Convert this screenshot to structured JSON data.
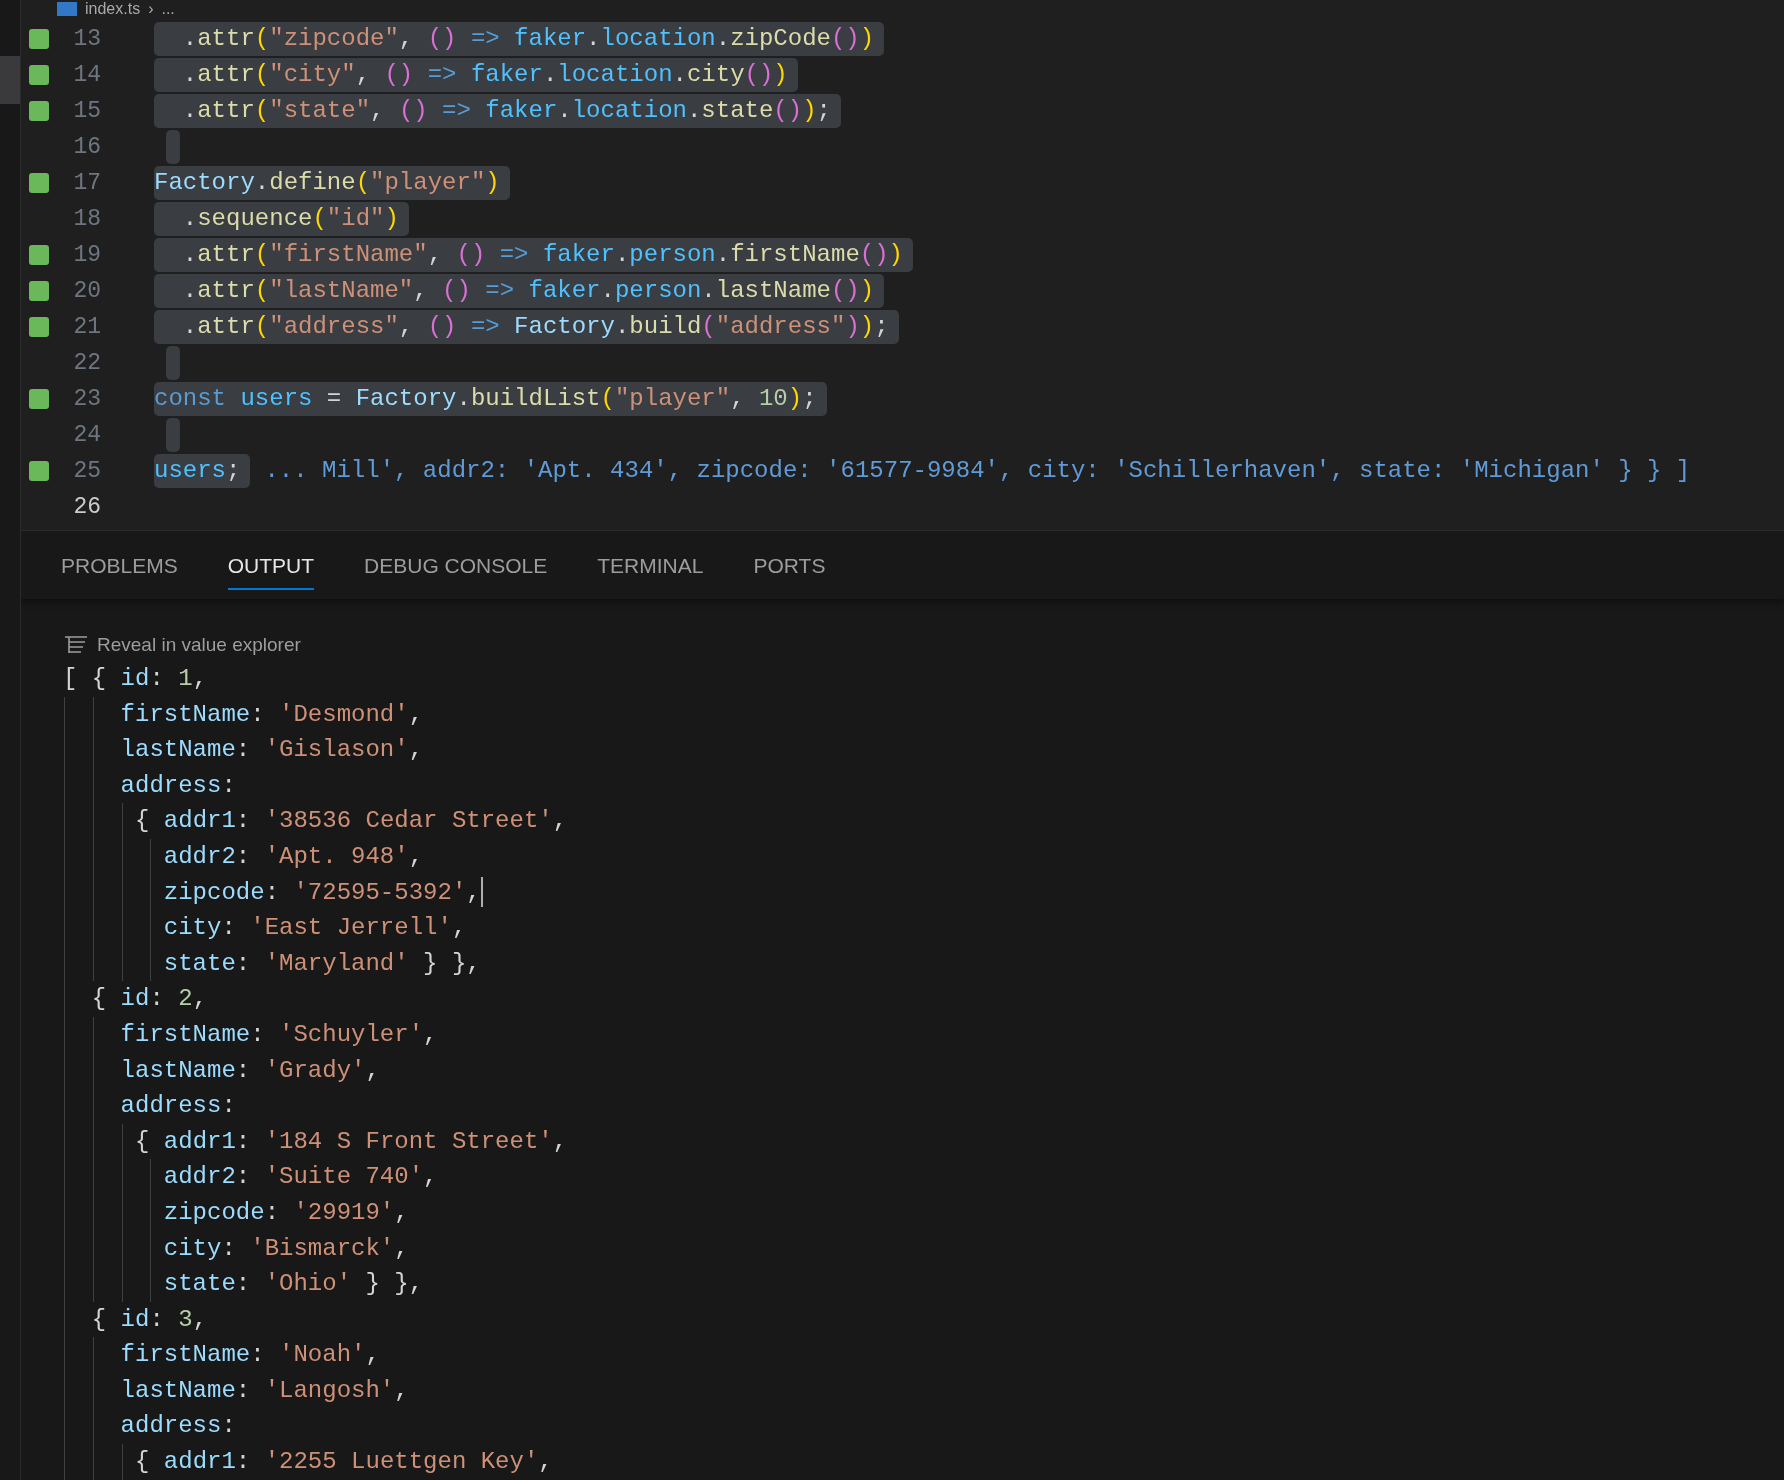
{
  "breadcrumb": {
    "file": "index.ts",
    "separator": "›",
    "rest": "..."
  },
  "editor": {
    "lines": [
      {
        "number": "13",
        "changed": true,
        "selected": true,
        "current": false,
        "tokens": [
          {
            "kind": "plain",
            "text": "  ."
          },
          {
            "kind": "func",
            "text": "attr"
          },
          {
            "kind": "bracket1",
            "text": "("
          },
          {
            "kind": "string",
            "text": "\"zipcode\""
          },
          {
            "kind": "plain",
            "text": ", "
          },
          {
            "kind": "bracket2",
            "text": "()"
          },
          {
            "kind": "keyword",
            "text": " => "
          },
          {
            "kind": "var",
            "text": "faker"
          },
          {
            "kind": "plain",
            "text": "."
          },
          {
            "kind": "var",
            "text": "location"
          },
          {
            "kind": "plain",
            "text": "."
          },
          {
            "kind": "func",
            "text": "zipCode"
          },
          {
            "kind": "bracket2",
            "text": "()"
          },
          {
            "kind": "bracket1",
            "text": ")"
          }
        ]
      },
      {
        "number": "14",
        "changed": true,
        "selected": true,
        "current": false,
        "tokens": [
          {
            "kind": "plain",
            "text": "  ."
          },
          {
            "kind": "func",
            "text": "attr"
          },
          {
            "kind": "bracket1",
            "text": "("
          },
          {
            "kind": "string",
            "text": "\"city\""
          },
          {
            "kind": "plain",
            "text": ", "
          },
          {
            "kind": "bracket2",
            "text": "()"
          },
          {
            "kind": "keyword",
            "text": " => "
          },
          {
            "kind": "var",
            "text": "faker"
          },
          {
            "kind": "plain",
            "text": "."
          },
          {
            "kind": "var",
            "text": "location"
          },
          {
            "kind": "plain",
            "text": "."
          },
          {
            "kind": "func",
            "text": "city"
          },
          {
            "kind": "bracket2",
            "text": "()"
          },
          {
            "kind": "bracket1",
            "text": ")"
          }
        ]
      },
      {
        "number": "15",
        "changed": true,
        "selected": true,
        "current": false,
        "tokens": [
          {
            "kind": "plain",
            "text": "  ."
          },
          {
            "kind": "func",
            "text": "attr"
          },
          {
            "kind": "bracket1",
            "text": "("
          },
          {
            "kind": "string",
            "text": "\"state\""
          },
          {
            "kind": "plain",
            "text": ", "
          },
          {
            "kind": "bracket2",
            "text": "()"
          },
          {
            "kind": "keyword",
            "text": " => "
          },
          {
            "kind": "var",
            "text": "faker"
          },
          {
            "kind": "plain",
            "text": "."
          },
          {
            "kind": "var",
            "text": "location"
          },
          {
            "kind": "plain",
            "text": "."
          },
          {
            "kind": "func",
            "text": "state"
          },
          {
            "kind": "bracket2",
            "text": "()"
          },
          {
            "kind": "bracket1",
            "text": ")"
          },
          {
            "kind": "plain",
            "text": ";"
          }
        ]
      },
      {
        "number": "16",
        "changed": false,
        "selected": true,
        "current": false
      },
      {
        "number": "17",
        "changed": true,
        "selected": true,
        "current": false,
        "tokens": [
          {
            "kind": "type",
            "text": "Factory"
          },
          {
            "kind": "plain",
            "text": "."
          },
          {
            "kind": "func",
            "text": "define"
          },
          {
            "kind": "bracket1",
            "text": "("
          },
          {
            "kind": "string",
            "text": "\"player\""
          },
          {
            "kind": "bracket1",
            "text": ")"
          }
        ]
      },
      {
        "number": "18",
        "changed": false,
        "selected": true,
        "current": false,
        "tokens": [
          {
            "kind": "plain",
            "text": "  ."
          },
          {
            "kind": "func",
            "text": "sequence"
          },
          {
            "kind": "bracket1",
            "text": "("
          },
          {
            "kind": "string",
            "text": "\"id\""
          },
          {
            "kind": "bracket1",
            "text": ")"
          }
        ]
      },
      {
        "number": "19",
        "changed": true,
        "selected": true,
        "current": false,
        "tokens": [
          {
            "kind": "plain",
            "text": "  ."
          },
          {
            "kind": "func",
            "text": "attr"
          },
          {
            "kind": "bracket1",
            "text": "("
          },
          {
            "kind": "string",
            "text": "\"firstName\""
          },
          {
            "kind": "plain",
            "text": ", "
          },
          {
            "kind": "bracket2",
            "text": "()"
          },
          {
            "kind": "keyword",
            "text": " => "
          },
          {
            "kind": "var",
            "text": "faker"
          },
          {
            "kind": "plain",
            "text": "."
          },
          {
            "kind": "var",
            "text": "person"
          },
          {
            "kind": "plain",
            "text": "."
          },
          {
            "kind": "func",
            "text": "firstName"
          },
          {
            "kind": "bracket2",
            "text": "()"
          },
          {
            "kind": "bracket1",
            "text": ")"
          }
        ]
      },
      {
        "number": "20",
        "changed": true,
        "selected": true,
        "current": false,
        "tokens": [
          {
            "kind": "plain",
            "text": "  ."
          },
          {
            "kind": "func",
            "text": "attr"
          },
          {
            "kind": "bracket1",
            "text": "("
          },
          {
            "kind": "string",
            "text": "\"lastName\""
          },
          {
            "kind": "plain",
            "text": ", "
          },
          {
            "kind": "bracket2",
            "text": "()"
          },
          {
            "kind": "keyword",
            "text": " => "
          },
          {
            "kind": "var",
            "text": "faker"
          },
          {
            "kind": "plain",
            "text": "."
          },
          {
            "kind": "var",
            "text": "person"
          },
          {
            "kind": "plain",
            "text": "."
          },
          {
            "kind": "func",
            "text": "lastName"
          },
          {
            "kind": "bracket2",
            "text": "()"
          },
          {
            "kind": "bracket1",
            "text": ")"
          }
        ]
      },
      {
        "number": "21",
        "changed": true,
        "selected": true,
        "current": false,
        "tokens": [
          {
            "kind": "plain",
            "text": "  ."
          },
          {
            "kind": "func",
            "text": "attr"
          },
          {
            "kind": "bracket1",
            "text": "("
          },
          {
            "kind": "string",
            "text": "\"address\""
          },
          {
            "kind": "plain",
            "text": ", "
          },
          {
            "kind": "bracket2",
            "text": "()"
          },
          {
            "kind": "keyword",
            "text": " => "
          },
          {
            "kind": "type",
            "text": "Factory"
          },
          {
            "kind": "plain",
            "text": "."
          },
          {
            "kind": "func",
            "text": "build"
          },
          {
            "kind": "bracket2",
            "text": "("
          },
          {
            "kind": "string",
            "text": "\"address\""
          },
          {
            "kind": "bracket2",
            "text": ")"
          },
          {
            "kind": "bracket1",
            "text": ")"
          },
          {
            "kind": "plain",
            "text": ";"
          }
        ]
      },
      {
        "number": "22",
        "changed": false,
        "selected": true,
        "current": false
      },
      {
        "number": "23",
        "changed": true,
        "selected": true,
        "current": false,
        "tokens": [
          {
            "kind": "keyword",
            "text": "const "
          },
          {
            "kind": "var",
            "text": "users"
          },
          {
            "kind": "plain",
            "text": " = "
          },
          {
            "kind": "type",
            "text": "Factory"
          },
          {
            "kind": "plain",
            "text": "."
          },
          {
            "kind": "func",
            "text": "buildList"
          },
          {
            "kind": "bracket1",
            "text": "("
          },
          {
            "kind": "string",
            "text": "\"player\""
          },
          {
            "kind": "plain",
            "text": ", "
          },
          {
            "kind": "number",
            "text": "10"
          },
          {
            "kind": "bracket1",
            "text": ")"
          },
          {
            "kind": "plain",
            "text": ";"
          }
        ]
      },
      {
        "number": "24",
        "changed": false,
        "selected": true,
        "current": false
      },
      {
        "number": "25",
        "changed": true,
        "selected": true,
        "current": false,
        "tokens": [
          {
            "kind": "var",
            "text": "users"
          },
          {
            "kind": "plain",
            "text": ";"
          }
        ],
        "inline_result": "... Mill', addr2: 'Apt. 434', zipcode: '61577-9984', city: 'Schillerhaven', state: 'Michigan' } } ]"
      },
      {
        "number": "26",
        "changed": false,
        "selected": false,
        "current": true
      }
    ]
  },
  "panel": {
    "tabs": [
      {
        "label": "PROBLEMS",
        "selected": false
      },
      {
        "label": "OUTPUT",
        "selected": true
      },
      {
        "label": "DEBUG CONSOLE",
        "selected": false
      },
      {
        "label": "TERMINAL",
        "selected": false
      },
      {
        "label": "PORTS",
        "selected": false
      }
    ],
    "reveal_link": "Reveal in value explorer",
    "output": [
      {
        "caret": false,
        "tokens": [
          {
            "kind": "plain",
            "text": "[ { "
          },
          {
            "kind": "key",
            "text": "id"
          },
          {
            "kind": "plain",
            "text": ": "
          },
          {
            "kind": "number",
            "text": "1"
          },
          {
            "kind": "plain",
            "text": ","
          }
        ]
      },
      {
        "caret": false,
        "tokens": [
          {
            "kind": "key",
            "text": "    firstName"
          },
          {
            "kind": "plain",
            "text": ": "
          },
          {
            "kind": "string",
            "text": "'Desmond'"
          },
          {
            "kind": "plain",
            "text": ","
          }
        ]
      },
      {
        "caret": false,
        "tokens": [
          {
            "kind": "key",
            "text": "    lastName"
          },
          {
            "kind": "plain",
            "text": ": "
          },
          {
            "kind": "string",
            "text": "'Gislason'"
          },
          {
            "kind": "plain",
            "text": ","
          }
        ]
      },
      {
        "caret": false,
        "tokens": [
          {
            "kind": "key",
            "text": "    address"
          },
          {
            "kind": "plain",
            "text": ":"
          }
        ]
      },
      {
        "caret": false,
        "tokens": [
          {
            "kind": "plain",
            "text": "     { "
          },
          {
            "kind": "key",
            "text": "addr1"
          },
          {
            "kind": "plain",
            "text": ": "
          },
          {
            "kind": "string",
            "text": "'38536 Cedar Street'"
          },
          {
            "kind": "plain",
            "text": ","
          }
        ]
      },
      {
        "caret": false,
        "tokens": [
          {
            "kind": "key",
            "text": "       addr2"
          },
          {
            "kind": "plain",
            "text": ": "
          },
          {
            "kind": "string",
            "text": "'Apt. 948'"
          },
          {
            "kind": "plain",
            "text": ","
          }
        ]
      },
      {
        "caret": true,
        "tokens": [
          {
            "kind": "key",
            "text": "       zipcode"
          },
          {
            "kind": "plain",
            "text": ": "
          },
          {
            "kind": "string",
            "text": "'72595-5392'"
          },
          {
            "kind": "plain",
            "text": ","
          }
        ]
      },
      {
        "caret": false,
        "tokens": [
          {
            "kind": "key",
            "text": "       city"
          },
          {
            "kind": "plain",
            "text": ": "
          },
          {
            "kind": "string",
            "text": "'East Jerrell'"
          },
          {
            "kind": "plain",
            "text": ","
          }
        ]
      },
      {
        "caret": false,
        "tokens": [
          {
            "kind": "key",
            "text": "       state"
          },
          {
            "kind": "plain",
            "text": ": "
          },
          {
            "kind": "string",
            "text": "'Maryland'"
          },
          {
            "kind": "plain",
            "text": " } },"
          }
        ]
      },
      {
        "caret": false,
        "tokens": [
          {
            "kind": "plain",
            "text": "  { "
          },
          {
            "kind": "key",
            "text": "id"
          },
          {
            "kind": "plain",
            "text": ": "
          },
          {
            "kind": "number",
            "text": "2"
          },
          {
            "kind": "plain",
            "text": ","
          }
        ]
      },
      {
        "caret": false,
        "tokens": [
          {
            "kind": "key",
            "text": "    firstName"
          },
          {
            "kind": "plain",
            "text": ": "
          },
          {
            "kind": "string",
            "text": "'Schuyler'"
          },
          {
            "kind": "plain",
            "text": ","
          }
        ]
      },
      {
        "caret": false,
        "tokens": [
          {
            "kind": "key",
            "text": "    lastName"
          },
          {
            "kind": "plain",
            "text": ": "
          },
          {
            "kind": "string",
            "text": "'Grady'"
          },
          {
            "kind": "plain",
            "text": ","
          }
        ]
      },
      {
        "caret": false,
        "tokens": [
          {
            "kind": "key",
            "text": "    address"
          },
          {
            "kind": "plain",
            "text": ":"
          }
        ]
      },
      {
        "caret": false,
        "tokens": [
          {
            "kind": "plain",
            "text": "     { "
          },
          {
            "kind": "key",
            "text": "addr1"
          },
          {
            "kind": "plain",
            "text": ": "
          },
          {
            "kind": "string",
            "text": "'184 S Front Street'"
          },
          {
            "kind": "plain",
            "text": ","
          }
        ]
      },
      {
        "caret": false,
        "tokens": [
          {
            "kind": "key",
            "text": "       addr2"
          },
          {
            "kind": "plain",
            "text": ": "
          },
          {
            "kind": "string",
            "text": "'Suite 740'"
          },
          {
            "kind": "plain",
            "text": ","
          }
        ]
      },
      {
        "caret": false,
        "tokens": [
          {
            "kind": "key",
            "text": "       zipcode"
          },
          {
            "kind": "plain",
            "text": ": "
          },
          {
            "kind": "string",
            "text": "'29919'"
          },
          {
            "kind": "plain",
            "text": ","
          }
        ]
      },
      {
        "caret": false,
        "tokens": [
          {
            "kind": "key",
            "text": "       city"
          },
          {
            "kind": "plain",
            "text": ": "
          },
          {
            "kind": "string",
            "text": "'Bismarck'"
          },
          {
            "kind": "plain",
            "text": ","
          }
        ]
      },
      {
        "caret": false,
        "tokens": [
          {
            "kind": "key",
            "text": "       state"
          },
          {
            "kind": "plain",
            "text": ": "
          },
          {
            "kind": "string",
            "text": "'Ohio'"
          },
          {
            "kind": "plain",
            "text": " } },"
          }
        ]
      },
      {
        "caret": false,
        "tokens": [
          {
            "kind": "plain",
            "text": "  { "
          },
          {
            "kind": "key",
            "text": "id"
          },
          {
            "kind": "plain",
            "text": ": "
          },
          {
            "kind": "number",
            "text": "3"
          },
          {
            "kind": "plain",
            "text": ","
          }
        ]
      },
      {
        "caret": false,
        "tokens": [
          {
            "kind": "key",
            "text": "    firstName"
          },
          {
            "kind": "plain",
            "text": ": "
          },
          {
            "kind": "string",
            "text": "'Noah'"
          },
          {
            "kind": "plain",
            "text": ","
          }
        ]
      },
      {
        "caret": false,
        "tokens": [
          {
            "kind": "key",
            "text": "    lastName"
          },
          {
            "kind": "plain",
            "text": ": "
          },
          {
            "kind": "string",
            "text": "'Langosh'"
          },
          {
            "kind": "plain",
            "text": ","
          }
        ]
      },
      {
        "caret": false,
        "tokens": [
          {
            "kind": "key",
            "text": "    address"
          },
          {
            "kind": "plain",
            "text": ":"
          }
        ]
      },
      {
        "caret": false,
        "tokens": [
          {
            "kind": "plain",
            "text": "     { "
          },
          {
            "kind": "key",
            "text": "addr1"
          },
          {
            "kind": "plain",
            "text": ": "
          },
          {
            "kind": "string",
            "text": "'2255 Luettgen Key'"
          },
          {
            "kind": "plain",
            "text": ","
          }
        ]
      }
    ]
  }
}
